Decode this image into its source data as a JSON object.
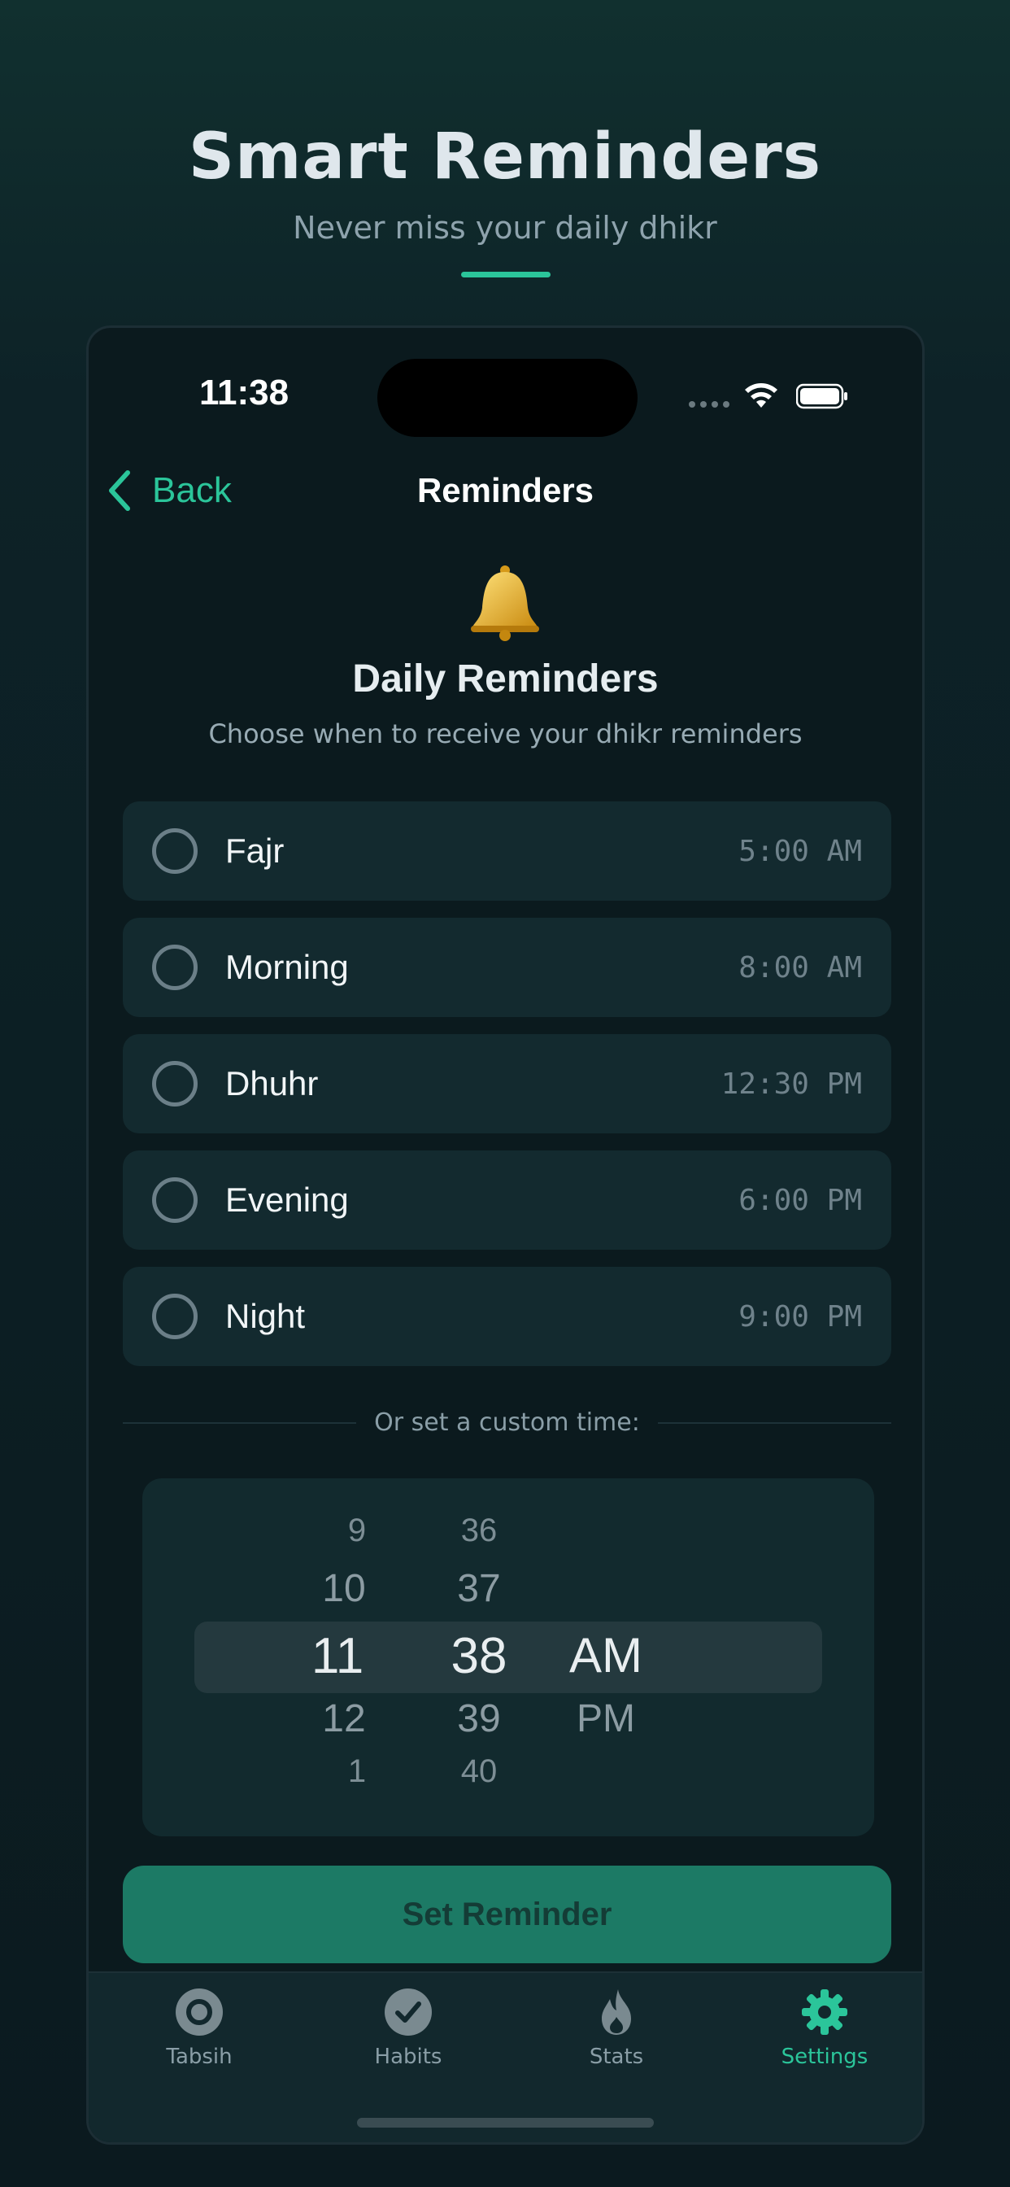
{
  "hero": {
    "title": "Smart Reminders",
    "subtitle": "Never miss your daily dhikr"
  },
  "status_bar": {
    "time": "11:38"
  },
  "nav": {
    "back_label": "Back",
    "title": "Reminders"
  },
  "section": {
    "icon": "bell-icon",
    "title": "Daily Reminders",
    "subtitle": "Choose when to receive your dhikr reminders"
  },
  "reminders": [
    {
      "label": "Fajr",
      "time": "5:00 AM"
    },
    {
      "label": "Morning",
      "time": "8:00 AM"
    },
    {
      "label": "Dhuhr",
      "time": "12:30 PM"
    },
    {
      "label": "Evening",
      "time": "6:00 PM"
    },
    {
      "label": "Night",
      "time": "9:00 PM"
    }
  ],
  "custom_time_label": "Or set a custom time:",
  "picker": {
    "hours": [
      "9",
      "10",
      "11",
      "12",
      "1"
    ],
    "minutes": [
      "36",
      "37",
      "38",
      "39",
      "40"
    ],
    "periods": [
      "AM",
      "PM"
    ],
    "selected": {
      "hour": "11",
      "minute": "38",
      "period": "AM"
    }
  },
  "set_button_label": "Set Reminder",
  "tabs": [
    {
      "label": "Tabsih",
      "icon": "tasbih-icon",
      "active": false
    },
    {
      "label": "Habits",
      "icon": "check-icon",
      "active": false
    },
    {
      "label": "Stats",
      "icon": "flame-icon",
      "active": false
    },
    {
      "label": "Settings",
      "icon": "gear-icon",
      "active": true
    }
  ],
  "colors": {
    "accent": "#2bc59a",
    "button": "#1c7a65",
    "card": "#132a2f",
    "background": "#0b1a1e"
  }
}
